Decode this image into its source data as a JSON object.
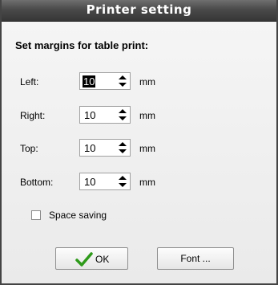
{
  "window": {
    "title": "Printer setting"
  },
  "heading": "Set margins for table print:",
  "margins": [
    {
      "label": "Left:",
      "value": "10",
      "unit": "mm",
      "selected": true
    },
    {
      "label": "Right:",
      "value": "10",
      "unit": "mm",
      "selected": false
    },
    {
      "label": "Top:",
      "value": "10",
      "unit": "mm",
      "selected": false
    },
    {
      "label": "Bottom:",
      "value": "10",
      "unit": "mm",
      "selected": false
    }
  ],
  "space_saving": {
    "label": "Space saving",
    "checked": false
  },
  "buttons": {
    "ok": "OK",
    "font": "Font ..."
  },
  "colors": {
    "titlebar": "#4a4a4a",
    "ok_check": "#2e9a1a"
  },
  "icons": {
    "ok": "checkmark-icon",
    "spinner": "spin-arrows-icon"
  }
}
